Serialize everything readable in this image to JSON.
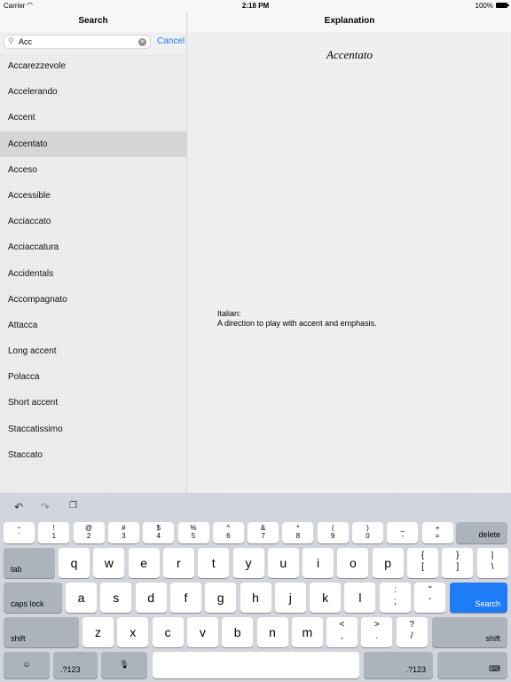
{
  "status": {
    "carrier": "Carrier",
    "time": "2:18 PM",
    "battery": "100%"
  },
  "left": {
    "title": "Search",
    "search_value": "Acc",
    "cancel_label": "Cancel",
    "results": [
      "Accarezzevole",
      "Accelerando",
      "Accent",
      "Accentato",
      "Acceso",
      "Accessible",
      "Acciaccato",
      "Acciaccatura",
      "Accidentals",
      "Accompagnato",
      "Attacca",
      "Long accent",
      "Polacca",
      "Short accent",
      "Staccatissimo",
      "Staccato"
    ],
    "selected_index": 3
  },
  "right": {
    "title": "Explanation",
    "term": "Accentato",
    "language": "Italian:",
    "definition": "A direction to play with accent and emphasis."
  },
  "keyboard": {
    "num_row": [
      {
        "top": "~",
        "bot": "`"
      },
      {
        "top": "!",
        "bot": "1"
      },
      {
        "top": "@",
        "bot": "2"
      },
      {
        "top": "#",
        "bot": "3"
      },
      {
        "top": "$",
        "bot": "4"
      },
      {
        "top": "%",
        "bot": "5"
      },
      {
        "top": "^",
        "bot": "6"
      },
      {
        "top": "&",
        "bot": "7"
      },
      {
        "top": "*",
        "bot": "8"
      },
      {
        "top": "(",
        "bot": "9"
      },
      {
        "top": ")",
        "bot": "0"
      },
      {
        "top": "_",
        "bot": "-"
      },
      {
        "top": "+",
        "bot": "="
      }
    ],
    "delete": "delete",
    "tab": "tab",
    "row2": [
      "q",
      "w",
      "e",
      "r",
      "t",
      "y",
      "u",
      "i",
      "o",
      "p"
    ],
    "row2_sym": [
      {
        "top": "{",
        "bot": "["
      },
      {
        "top": "}",
        "bot": "]"
      },
      {
        "top": "|",
        "bot": "\\"
      }
    ],
    "caps": "caps lock",
    "row3": [
      "a",
      "s",
      "d",
      "f",
      "g",
      "h",
      "j",
      "k",
      "l"
    ],
    "row3_sym": [
      {
        "top": ":",
        "bot": ";"
      },
      {
        "top": "\"",
        "bot": "'"
      }
    ],
    "search": "Search",
    "shift": "shift",
    "row4": [
      "z",
      "x",
      "c",
      "v",
      "b",
      "n",
      "m"
    ],
    "row4_sym": [
      {
        "top": "<",
        "bot": ","
      },
      {
        "top": ">",
        "bot": "."
      },
      {
        "top": "?",
        "bot": "/"
      }
    ],
    "numkey": ".?123",
    "emoji": "☺",
    "mic": "🎙",
    "hide": "⌨"
  }
}
